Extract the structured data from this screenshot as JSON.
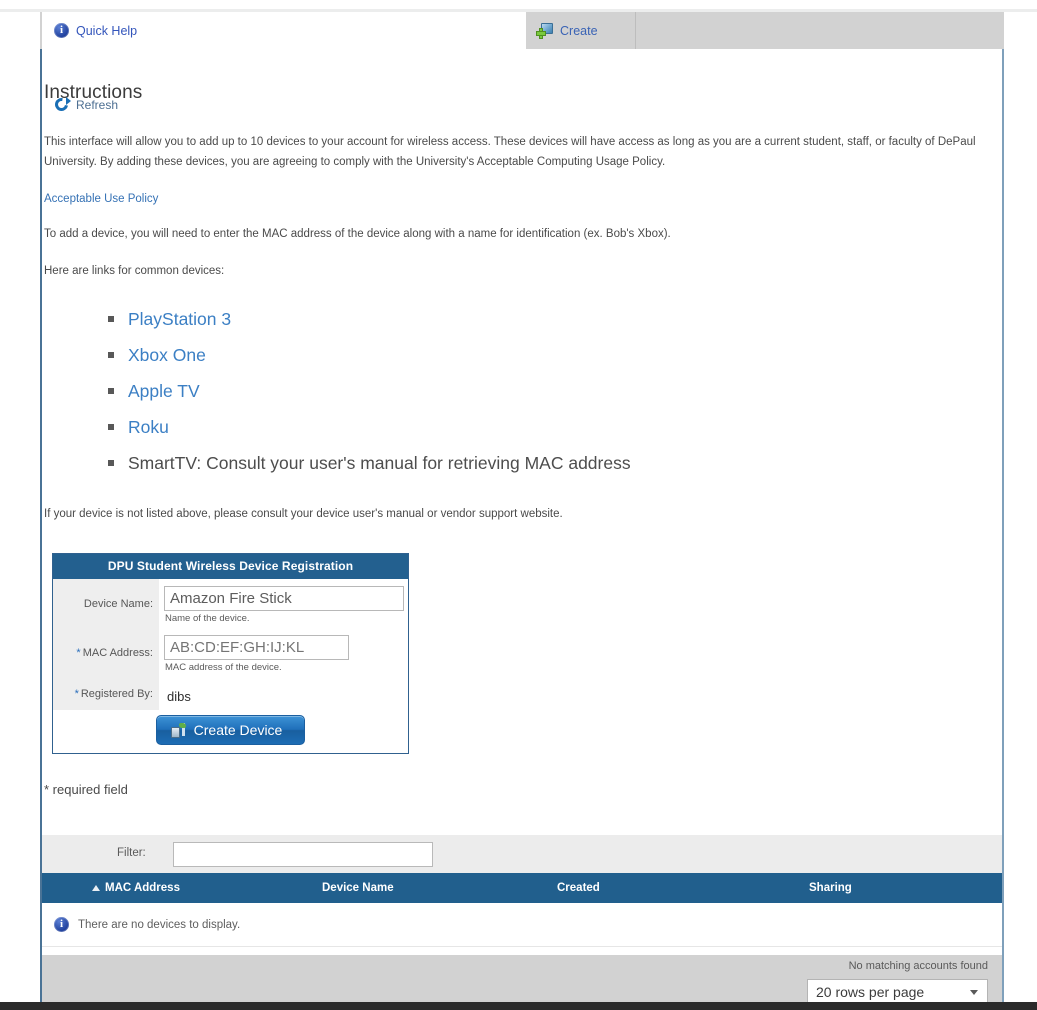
{
  "tabs": [
    {
      "id": "quick-help",
      "label": "Quick Help",
      "icon": "info-icon",
      "active": true
    },
    {
      "id": "create",
      "label": "Create",
      "icon": "create-window-plus-icon",
      "active": false
    }
  ],
  "page": {
    "title": "Instructions",
    "intro": "This interface will allow you to add up to 10 devices to your account for wireless access. These devices will have access as long as you are a current student, staff, or faculty of DePaul University. By adding these devices, you are agreeing to comply with the University's Acceptable Computing Usage Policy.",
    "policy_link": "Acceptable Use Policy",
    "add_device_note": "To add a device, you will need to enter the MAC address of the device along with a name for identification (ex. Bob's Xbox).",
    "links_intro": "Here are links for common devices:",
    "not_listed_note": "If your device is not listed above, please consult your device user's manual or vendor support website.",
    "required_note": "* required field"
  },
  "device_links": [
    {
      "label": "PlayStation 3",
      "is_link": true
    },
    {
      "label": "Xbox One",
      "is_link": true
    },
    {
      "label": "Apple TV",
      "is_link": true
    },
    {
      "label": "Roku",
      "is_link": true
    },
    {
      "label": "SmartTV: Consult your user's manual for retrieving MAC address",
      "is_link": false
    }
  ],
  "form": {
    "header": "DPU Student Wireless Device Registration",
    "device_name": {
      "label": "Device Name:",
      "value": "Amazon Fire Stick",
      "placeholder": "",
      "hint": "Name of the device.",
      "required": false
    },
    "mac_address": {
      "label": "MAC Address:",
      "value": "",
      "placeholder": "AB:CD:EF:GH:IJ:KL",
      "hint": "MAC address of the device.",
      "required": true,
      "required_marker": "*"
    },
    "registered_by": {
      "label": "Registered By:",
      "value": "dibs",
      "required": true,
      "required_marker": "*"
    },
    "submit_label": "Create Device"
  },
  "filter": {
    "label": "Filter:",
    "value": "",
    "placeholder": ""
  },
  "table": {
    "columns": [
      {
        "label": "MAC Address",
        "sorted": "asc"
      },
      {
        "label": "Device Name",
        "sorted": ""
      },
      {
        "label": "Created",
        "sorted": ""
      },
      {
        "label": "Sharing",
        "sorted": ""
      }
    ],
    "rows": [],
    "empty_message": "There are no devices to display."
  },
  "footer": {
    "refresh_label": "Refresh",
    "status": "No matching accounts found",
    "rows_per_page": "20 rows per page",
    "rows_per_page_options": [
      "20 rows per page"
    ]
  },
  "colors": {
    "header_blue": "#215f8d",
    "link_blue": "#3672b5",
    "accent_blue": "#2a6ebb",
    "toolbar_gray": "#d2d2d2"
  }
}
